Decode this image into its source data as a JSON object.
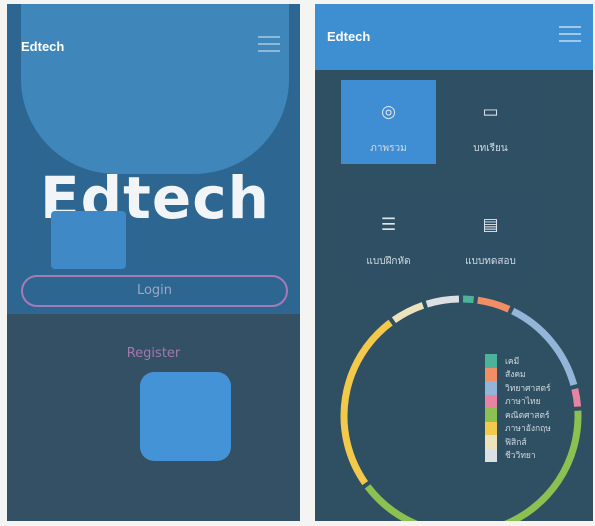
{
  "left_screen": {
    "brand": "Edtech",
    "hero_title": "Edtech",
    "login_label": "Login",
    "register_label": "Register",
    "menu_icon": "hamburger-icon"
  },
  "right_screen": {
    "brand": "Edtech",
    "menu_icon": "hamburger-icon",
    "tiles": [
      {
        "label": "ภาพรวม",
        "icon": "globe-icon",
        "glyph": "◎"
      },
      {
        "label": "บทเรียน",
        "icon": "book-icon",
        "glyph": "▭"
      },
      {
        "label": "แบบฝึกหัด",
        "icon": "list-icon",
        "glyph": "☰"
      },
      {
        "label": "แบบทดสอบ",
        "icon": "clipboard-icon",
        "glyph": "▤"
      }
    ]
  },
  "chart_data": {
    "type": "pie",
    "categories": [
      "เคมี",
      "สังคม",
      "วิทยาศาสตร์",
      "ภาษาไทย",
      "คณิตศาสตร์",
      "ภาษาอังกฤษ",
      "ฟิสิกส์",
      "ชีววิทยา"
    ],
    "values": [
      2,
      5,
      14,
      3,
      41,
      25,
      5,
      5
    ],
    "colors": [
      "#4cb39a",
      "#f08f66",
      "#93b6d8",
      "#e784a4",
      "#8cc152",
      "#f3c94b",
      "#ece3bc",
      "#dcdfe4"
    ],
    "legend_position": "inside-right"
  }
}
